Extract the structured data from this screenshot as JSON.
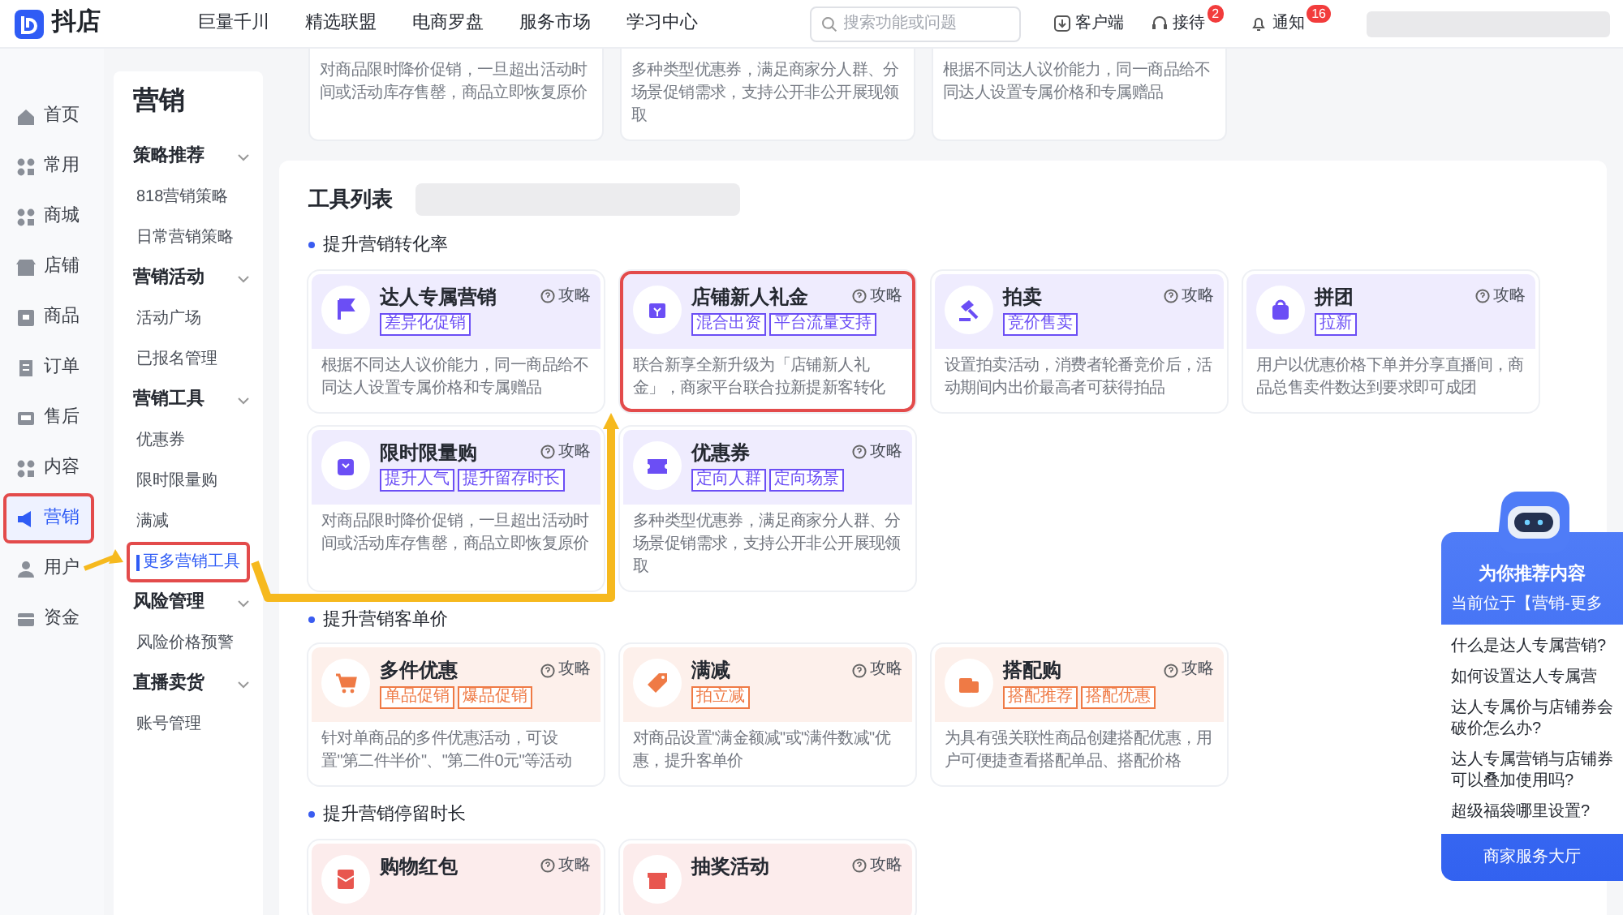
{
  "topbar": {
    "logo": "抖店",
    "nav": [
      "巨量千川",
      "精选联盟",
      "电商罗盘",
      "服务市场",
      "学习中心"
    ],
    "search": {
      "placeholder": "搜索功能或问题"
    },
    "actions": [
      {
        "kind": "download",
        "label": "客户端"
      },
      {
        "kind": "headset",
        "label": "接待",
        "badge": "2"
      },
      {
        "kind": "bell",
        "label": "通知",
        "badge": "16"
      }
    ]
  },
  "main_nav": {
    "items": [
      {
        "label": "首页",
        "selected": false,
        "annotated": false
      },
      {
        "label": "常用",
        "selected": false,
        "annotated": false
      },
      {
        "label": "商城",
        "selected": false,
        "annotated": false
      },
      {
        "label": "店铺",
        "selected": false,
        "annotated": false
      },
      {
        "label": "商品",
        "selected": false,
        "annotated": false
      },
      {
        "label": "订单",
        "selected": false,
        "annotated": false
      },
      {
        "label": "售后",
        "selected": false,
        "annotated": false
      },
      {
        "label": "内容",
        "selected": false,
        "annotated": false
      },
      {
        "label": "营销",
        "selected": true,
        "annotated": true
      },
      {
        "label": "用户",
        "selected": false,
        "annotated": false
      },
      {
        "label": "资金",
        "selected": false,
        "annotated": false
      }
    ]
  },
  "sub_nav": {
    "title": "营销",
    "groups": [
      {
        "label": "策略推荐",
        "expanded": true,
        "items": [
          {
            "label": "818营销策略",
            "selected": false,
            "annotated": false
          },
          {
            "label": "日常营销策略",
            "selected": false,
            "annotated": false
          }
        ]
      },
      {
        "label": "营销活动",
        "expanded": true,
        "items": [
          {
            "label": "活动广场",
            "selected": false,
            "annotated": false
          },
          {
            "label": "已报名管理",
            "selected": false,
            "annotated": false
          }
        ]
      },
      {
        "label": "营销工具",
        "expanded": true,
        "items": [
          {
            "label": "优惠券",
            "selected": false,
            "annotated": false
          },
          {
            "label": "限时限量购",
            "selected": false,
            "annotated": false
          },
          {
            "label": "满减",
            "selected": false,
            "annotated": false
          },
          {
            "label": "更多营销工具",
            "selected": true,
            "annotated": true
          }
        ]
      },
      {
        "label": "风险管理",
        "expanded": true,
        "items": [
          {
            "label": "风险价格预警",
            "selected": false,
            "annotated": false
          }
        ]
      },
      {
        "label": "直播卖货",
        "expanded": true,
        "items": [
          {
            "label": "账号管理",
            "selected": false,
            "annotated": false
          }
        ]
      }
    ]
  },
  "scrolled_cards": [
    {
      "description": "对商品限时降价促销，一旦超出活动时间或活动库存售罄，商品立即恢复原价"
    },
    {
      "description": "多种类型优惠券，满足商家分人群、分场景促销需求，支持公开非公开展现领取"
    },
    {
      "description": "根据不同达人议价能力，同一商品给不同达人设置专属价格和专属赠品"
    }
  ],
  "tools": {
    "title": "工具列表",
    "sections": [
      {
        "label": "提升营销转化率",
        "color": "#6b4ef5",
        "cards": [
          {
            "title": "达人专属营销",
            "tags": [
              "差异化促销"
            ],
            "guide": "攻略",
            "description": "根据不同达人议价能力，同一商品给不同达人设置专属价格和专属赠品",
            "annotated": false
          },
          {
            "title": "店铺新人礼金",
            "tags": [
              "混合出资",
              "平台流量支持"
            ],
            "guide": "攻略",
            "description": "联合新享全新升级为「店铺新人礼金」，商家平台联合拉新提新客转化",
            "annotated": true
          },
          {
            "title": "拍卖",
            "tags": [
              "竞价售卖"
            ],
            "guide": "攻略",
            "description": "设置拍卖活动，消费者轮番竞价后，活动期间内出价最高者可获得拍品",
            "annotated": false
          },
          {
            "title": "拼团",
            "tags": [
              "拉新"
            ],
            "guide": "攻略",
            "description": "用户以优惠价格下单并分享直播间，商品总售卖件数达到要求即可成团",
            "annotated": false
          },
          {
            "title": "限时限量购",
            "tags": [
              "提升人气",
              "提升留存时长"
            ],
            "guide": "攻略",
            "description": "对商品限时降价促销，一旦超出活动时间或活动库存售罄，商品立即恢复原价",
            "annotated": false
          },
          {
            "title": "优惠券",
            "tags": [
              "定向人群",
              "定向场景"
            ],
            "guide": "攻略",
            "description": "多种类型优惠券，满足商家分人群、分场景促销需求，支持公开非公开展现领取",
            "annotated": false
          }
        ]
      },
      {
        "label": "提升营销客单价",
        "color": "#ef7a45",
        "cards": [
          {
            "title": "多件优惠",
            "tags": [
              "单品促销",
              "爆品促销"
            ],
            "guide": "攻略",
            "description": "针对单商品的多件优惠活动，可设置\"第二件半价\"、\"第二件0元\"等活动",
            "annotated": false
          },
          {
            "title": "满减",
            "tags": [
              "拍立减"
            ],
            "guide": "攻略",
            "description": "对商品设置\"满金额减\"或\"满件数减\"优惠，提升客单价",
            "annotated": false
          },
          {
            "title": "搭配购",
            "tags": [
              "搭配推荐",
              "搭配优惠"
            ],
            "guide": "攻略",
            "description": "为具有强关联性商品创建搭配优惠，用户可便捷查看搭配单品、搭配价格",
            "annotated": false
          }
        ]
      },
      {
        "label": "提升营销停留时长",
        "color": "#e8564f",
        "cards": [
          {
            "title": "购物红包",
            "guide": "攻略",
            "annotated": false
          },
          {
            "title": "抽奖活动",
            "guide": "攻略",
            "annotated": false
          }
        ]
      }
    ]
  },
  "assistant": {
    "title": "为你推荐内容",
    "location": "当前位于【营销-更多",
    "questions": [
      "什么是达人专属营销?",
      "如何设置达人专属营",
      "达人专属价与店铺券会破价怎么办?",
      "达人专属营销与店铺券可以叠加使用吗?",
      "超级福袋哪里设置?"
    ],
    "button": "商家服务大厅"
  }
}
